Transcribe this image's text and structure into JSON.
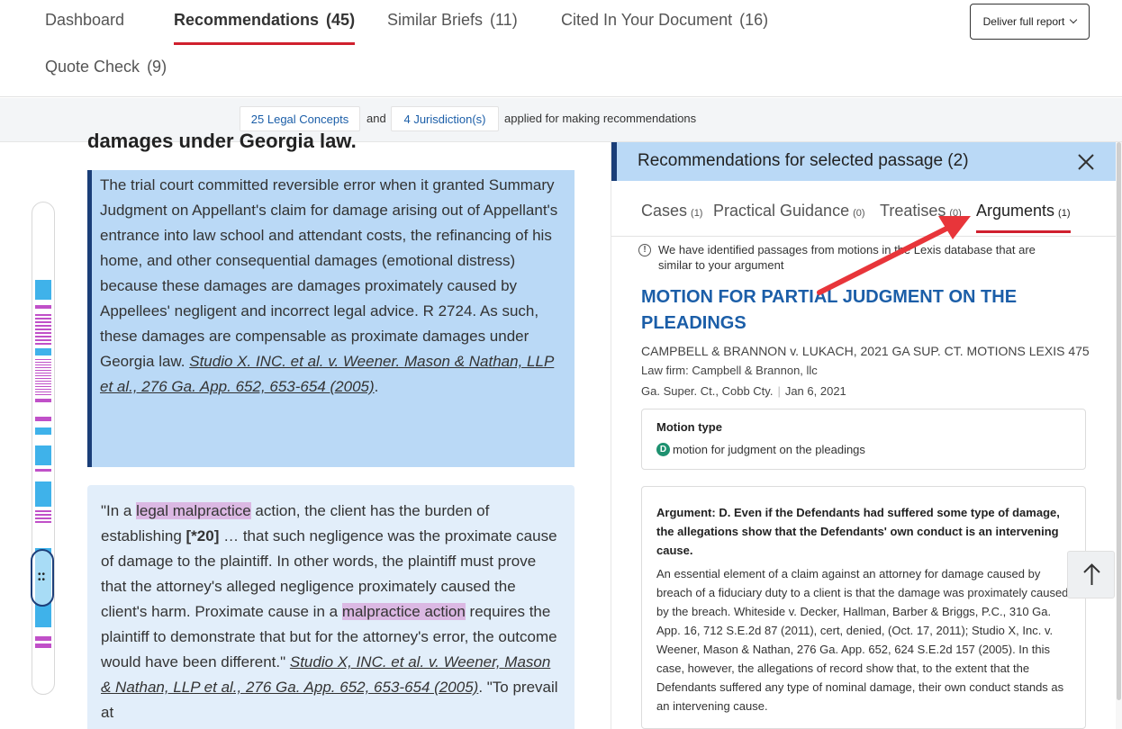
{
  "topnav": {
    "tabs": [
      {
        "label": "Dashboard",
        "count": ""
      },
      {
        "label": "Recommendations",
        "count": "(45)"
      },
      {
        "label": "Similar Briefs",
        "count": "(11)"
      },
      {
        "label": "Cited In Your Document",
        "count": "(16)"
      },
      {
        "label": "Quote Check",
        "count": "(9)"
      }
    ],
    "active_tab": "Recommendations",
    "deliver_label": "Deliver full report"
  },
  "applied_bar": {
    "concepts": "25 Legal Concepts",
    "and_word": "and",
    "jurisdictions": "4 Jurisdiction(s)",
    "suffix": "applied for making recommendations"
  },
  "document": {
    "heading": "damages under Georgia law.",
    "passage1": {
      "text": "The trial court committed reversible error when it granted Summary Judgment on Appellant's claim for damage arising out of Appellant's entrance into law school and attendant costs, the refinancing of his home, and other consequential damages (emotional distress) because these damages are damages proximately caused by Appellees' negligent and incorrect legal advice. R 2724. As such, these damages are compensable as proximate damages under Georgia law.",
      "citation": "Studio X. INC. et al. v. Weener. Mason & Nathan, LLP et al., 276 Ga. App. 652, 653-654 (2005)",
      "end": "."
    },
    "passage2": {
      "t1": "\"In a ",
      "h1": "legal malpractice",
      "t2": " action, the client has the burden of establishing ",
      "b1": "[*20]",
      "t3": " … that such negligence was the proximate cause of damage to the plaintiff. In other words, the plaintiff must prove that the attorney's alleged negligence proximately caused the client's harm. Proximate cause in a ",
      "h2": "malpractice action",
      "t4": " requires the plaintiff to demonstrate that but for the attorney's error, the outcome would have been different.\" ",
      "citation": "Studio X, INC. et al. v. Weener, Mason & Nathan, LLP et al., 276 Ga. App. 652, 653-654 (2005)",
      "t5": ". \"To prevail at"
    }
  },
  "panel": {
    "title": "Recommendations for selected passage (2)",
    "tabs": [
      {
        "label": "Cases",
        "count": "(1)"
      },
      {
        "label": "Practical Guidance",
        "count": "(0)"
      },
      {
        "label": "Treatises",
        "count": "(0)"
      },
      {
        "label": "Arguments",
        "count": "(1)"
      }
    ],
    "active_tab": "Arguments",
    "info": "We have identified passages from motions in the Lexis database that are similar to your argument",
    "result": {
      "title": "MOTION FOR PARTIAL JUDGMENT ON THE PLEADINGS",
      "citation": "CAMPBELL & BRANNON v. LUKACH, 2021 GA SUP. CT. MOTIONS LEXIS 475",
      "law_firm": "Law firm: Campbell & Brannon, llc",
      "court": "Ga. Super. Ct., Cobb Cty.",
      "date": "Jan 6, 2021",
      "motion_type_label": "Motion type",
      "motion_badge": "D",
      "motion_type": "motion for judgment on the pleadings",
      "argument_title": "Argument: D. Even if the Defendants had suffered some type of damage, the allegations show that the Defendants' own conduct is an intervening cause.",
      "argument_body": "An essential element of a claim against an attorney for damage caused by breach of a fiduciary duty to a client is that the damage was proximately caused by the breach. Whiteside v. Decker, Hallman, Barber & Briggs, P.C., 310 Ga. App. 16, 712 S.E.2d 87 (2011), cert, denied, (Oct. 17, 2011); Studio X, Inc. v. Weener, Mason & Nathan, 276 Ga. App. 652, 624 S.E.2d 157 (2005). In this case, however, the allegations of record show that, to the extent that the Defendants suffered any type of nominal damage, their own conduct stands as an intervening cause."
    }
  },
  "icons": {
    "close": "close-icon",
    "info": "info-icon",
    "scroll_up": "arrow-up-icon",
    "deliver_chevron": "chevron-down-icon"
  },
  "colors": {
    "accent_red": "#d0202e",
    "link_blue": "#1b5ea8",
    "selected_passage_bg": "#bad9f6",
    "passage_bg": "#e2eefa",
    "highlight": "#dbb8e3",
    "dark_navy": "#1a3e78",
    "badge_green": "#1e9170",
    "annotation_arrow": "#e8353a"
  }
}
